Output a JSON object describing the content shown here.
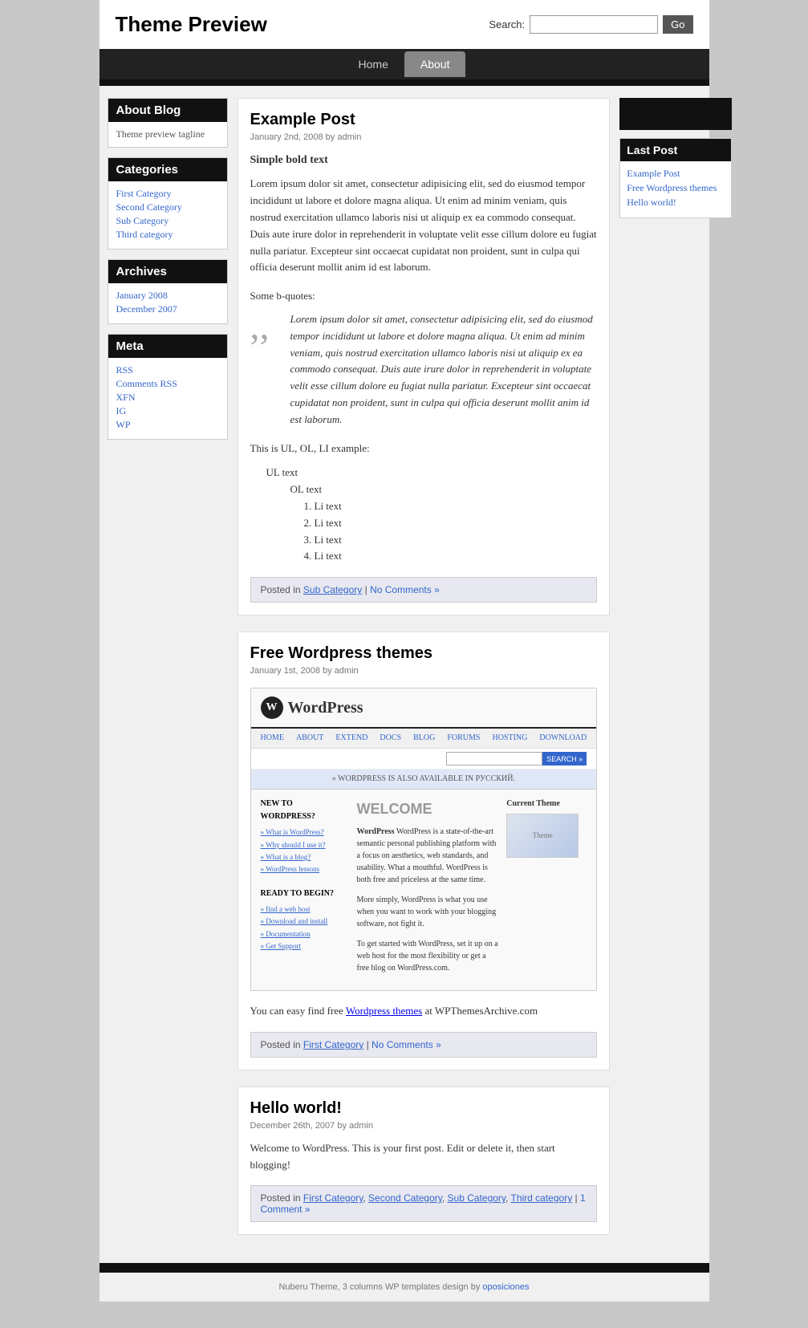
{
  "site": {
    "title": "Theme Preview",
    "tagline": "Theme preview tagline"
  },
  "search": {
    "label": "Search:",
    "placeholder": "",
    "button": "Go"
  },
  "nav": {
    "items": [
      {
        "label": "Home",
        "active": false
      },
      {
        "label": "About",
        "active": true
      }
    ]
  },
  "sidebar": {
    "about": {
      "title": "About Blog",
      "tagline": "Theme preview tagline"
    },
    "categories": {
      "title": "Categories",
      "items": [
        "First Category",
        "Second Category",
        "Sub Category",
        "Third category"
      ]
    },
    "archives": {
      "title": "Archives",
      "items": [
        "January 2008",
        "December 2007"
      ]
    },
    "meta": {
      "title": "Meta",
      "items": [
        "RSS",
        "Comments RSS",
        "XFN",
        "IG",
        "WP"
      ]
    }
  },
  "right_sidebar": {
    "last_post": {
      "title": "Last Post",
      "items": [
        "Example Post",
        "Free Wordpress themes",
        "Hello world!"
      ]
    }
  },
  "posts": [
    {
      "title": "Example Post",
      "date": "January 2nd, 2008 by admin",
      "bold_heading": "Simple bold text",
      "body": "Lorem ipsum dolor sit amet, consectetur adipisicing elit, sed do eiusmod tempor incididunt ut labore et dolore magna aliqua. Ut enim ad minim veniam, quis nostrud exercitation ullamco laboris nisi ut aliquip ex ea commodo consequat. Duis aute irure dolor in reprehenderit in voluptate velit esse cillum dolore eu fugiat nulla pariatur. Excepteur sint occaecat cupidatat non proident, sunt in culpa qui officia deserunt mollit anim id est laborum.",
      "bquote_label": "Some b-quotes:",
      "blockquote": "Lorem ipsum dolor sit amet, consectetur adipisicing elit, sed do eiusmod tempor incididunt ut labore et dolore magna aliqua. Ut enim ad minim veniam, quis nostrud exercitation ullamco laboris nisi ut aliquip ex ea commodo consequat. Duis aute irure dolor in reprehenderit in voluptate velit esse cillum dolore eu fugiat nulla pariatur. Excepteur sint occaecat cupidatat non proident, sunt in culpa qui officia deserunt mollit anim id est laborum.",
      "list_label": "This is UL, OL, LI example:",
      "ul_text": "UL text",
      "ol_text": "OL text",
      "li_items": [
        "Li text",
        "Li text",
        "Li text",
        "Li text"
      ],
      "footer": {
        "posted_in": "Posted in",
        "category": "Sub Category",
        "comments": "No Comments »"
      }
    },
    {
      "title": "Free Wordpress themes",
      "date": "January 1st, 2008 by admin",
      "body_text": "You can easy find free",
      "link_text": "Wordpress themes",
      "body_after": "at WPThemesArchive.com",
      "footer": {
        "posted_in": "Posted in",
        "category": "First Category",
        "comments": "No Comments »"
      }
    },
    {
      "title": "Hello world!",
      "date": "December 26th, 2007 by admin",
      "body": "Welcome to WordPress. This is your first post. Edit or delete it, then start blogging!",
      "footer": {
        "posted_in": "Posted in",
        "categories": [
          "First Category",
          "Second Category",
          "Sub Category",
          "Third category"
        ],
        "comments": "1 Comment »"
      }
    }
  ],
  "footer": {
    "text": "Nuberu Theme, 3 columns WP templates design by",
    "link": "oposiciones"
  },
  "wp_screenshot": {
    "logo_text": "WordPress",
    "nav_items": [
      "HOME",
      "ABOUT",
      "EXTEND",
      "DOCS",
      "BLOG",
      "FORUMS",
      "HOSTING",
      "DOWNLOAD"
    ],
    "notice": "» WORDPRESS IS ALSO AVAILABLE IN РУССКИЙ.",
    "welcome": "WELCOME",
    "body_text": "WordPress is a state-of-the-art semantic personal publishing platform with a focus on aesthetics, web standards, and usability. What a mouthful. WordPress is both free and priceless at the same time.",
    "body_text2": "More simply, WordPress is what you use when you want to work with your blogging software, not fight it.",
    "body_text3": "To get started with WordPress, set it up on a web host for the most flexibility or get a free blog on WordPress.com.",
    "ready_title": "READY TO BEGIN?",
    "sidebar_title": "NEW TO WORDPRESS?",
    "sidebar_links": [
      "» What is WordPress?",
      "» Why should I use it?",
      "» What is a blog?",
      "» WordPress lessons"
    ],
    "ready_links": [
      "» find a web host",
      "» Download and install",
      "» Documentation",
      "» Get Support"
    ],
    "current_theme": "Current Theme"
  }
}
